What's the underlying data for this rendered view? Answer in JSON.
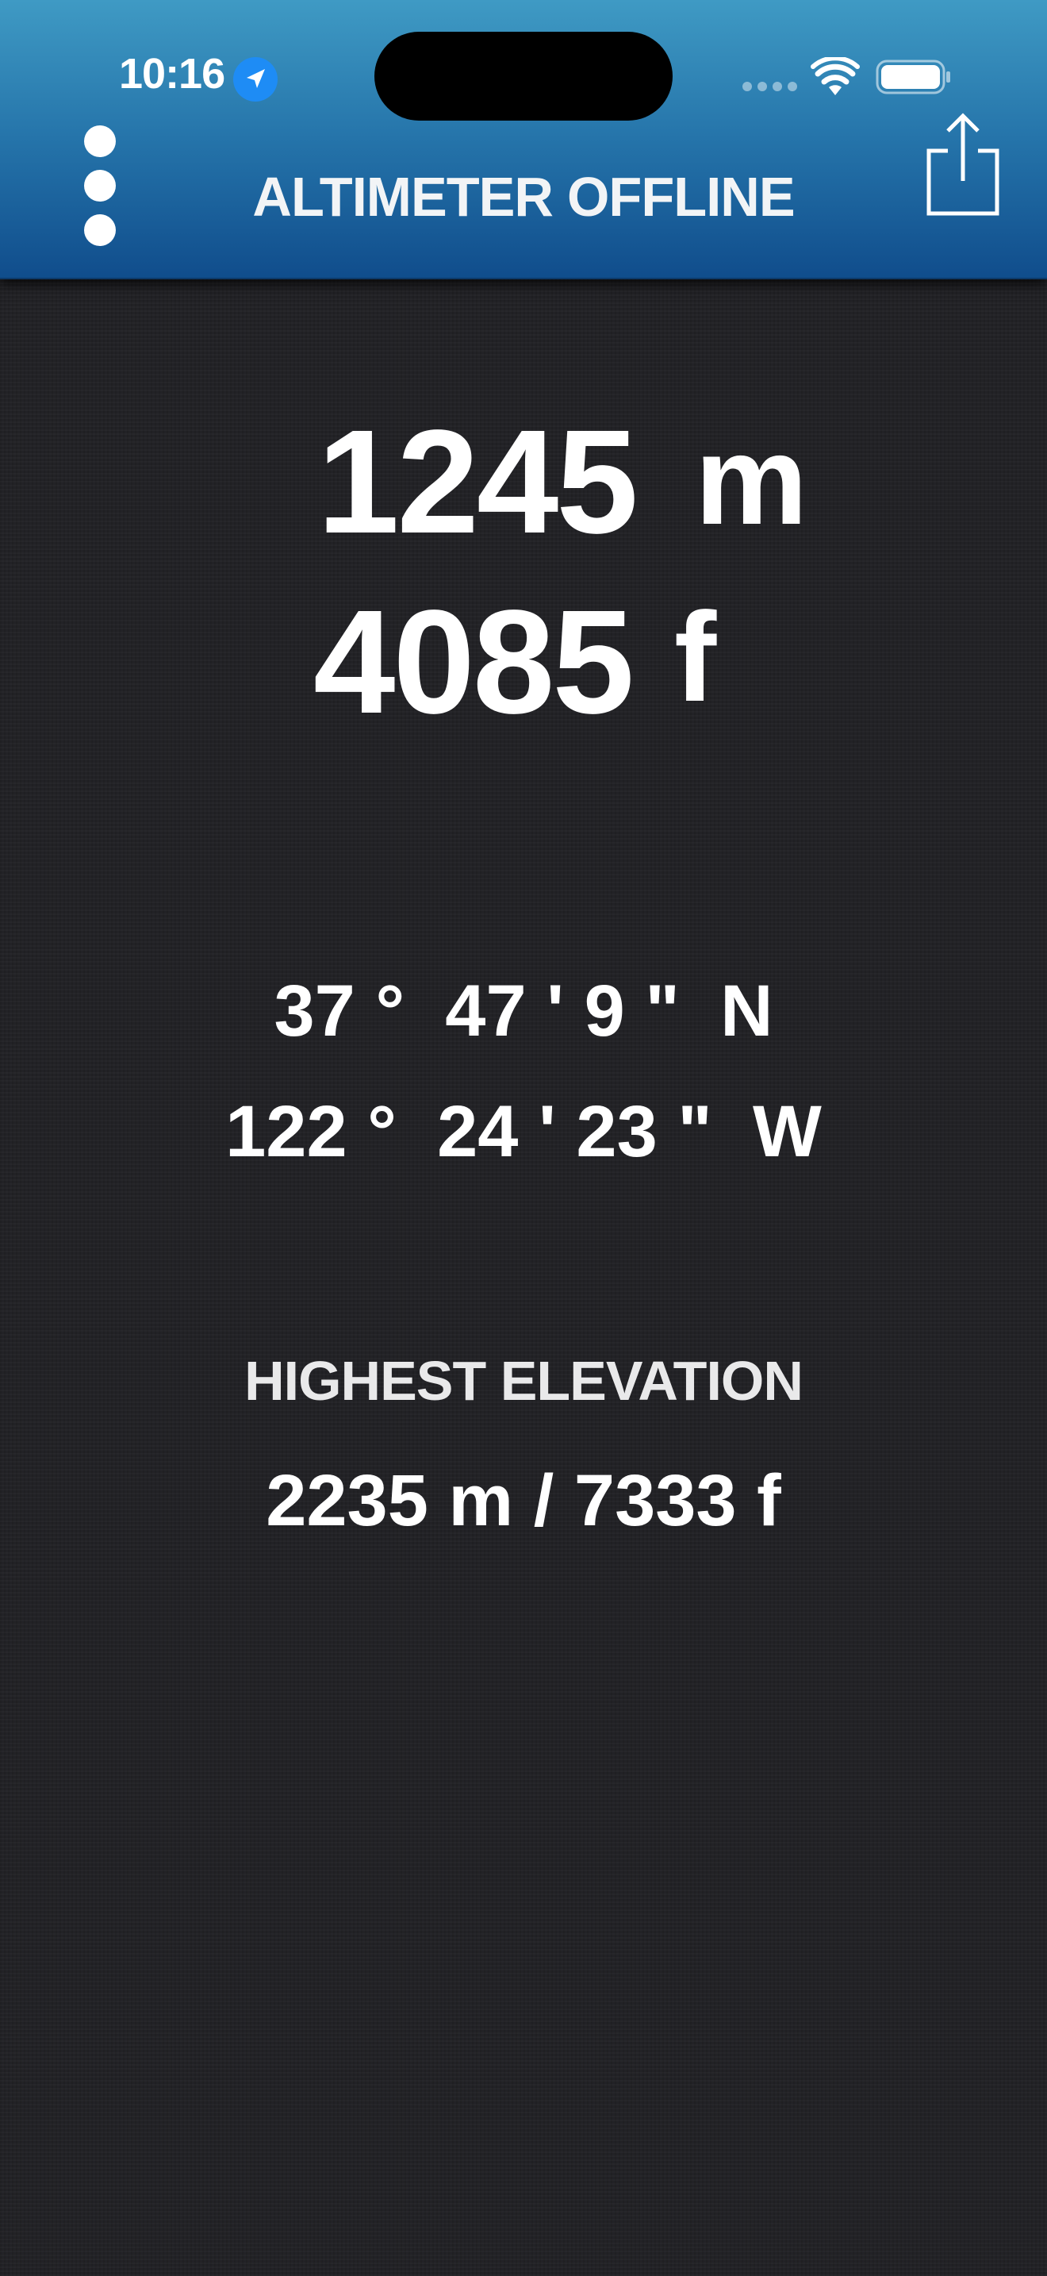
{
  "status_bar": {
    "time": "10:16",
    "location_icon": "location-arrow-icon",
    "signal_icon": "cellular-dots-icon",
    "wifi_icon": "wifi-icon",
    "battery_icon": "battery-icon"
  },
  "header": {
    "menu_icon": "more-vertical-icon",
    "title": "ALTIMETER OFFLINE",
    "share_icon": "share-icon",
    "gradient_top": "#3f9ac4",
    "gradient_bottom": "#104d8c"
  },
  "altitude": {
    "meters": "1245",
    "meters_unit": "m",
    "feet": "4085",
    "feet_unit": "f"
  },
  "coordinates": {
    "latitude": "37 °  47 ' 9 \"  N",
    "longitude": "122 °  24 ' 23 \"  W"
  },
  "highest_elevation": {
    "label": "HIGHEST ELEVATION",
    "value": "2235 m / 7333 f"
  },
  "colors": {
    "background": "#222226",
    "text": "#ffffff",
    "location_badge": "#1e8cf5"
  }
}
